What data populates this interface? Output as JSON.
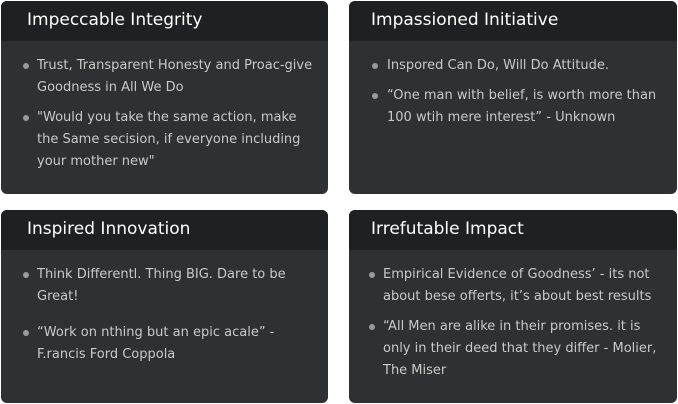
{
  "cards": [
    {
      "title": "Impeccable Integrity",
      "items": [
        "Trust, Transparent Honesty and Proac-give Goodness in All We Do",
        "\"Would you take the same action, make the Same secision, if everyone including your mother new\""
      ]
    },
    {
      "title": "Impassioned Initiative",
      "items": [
        "Inspored Can Do, Will Do Attitude.",
        "“One man with belief, is worth more than 100 wtih mere interest” - Unknown"
      ]
    },
    {
      "title": "Inspired Innovation",
      "items": [
        "Think Differentl. Thing BIG. Dare to be Great!",
        "“Work on nthing but an epic acale”  - F.rancis Ford Coppola"
      ]
    },
    {
      "title": "Irrefutable Impact",
      "items": [
        "Empirical Evidence of Goodness’ - its not about bese offerts, it’s about best results",
        "“All Men are alike in their promises. it is only in their deed that they differ - Molier, The Miser"
      ]
    }
  ]
}
